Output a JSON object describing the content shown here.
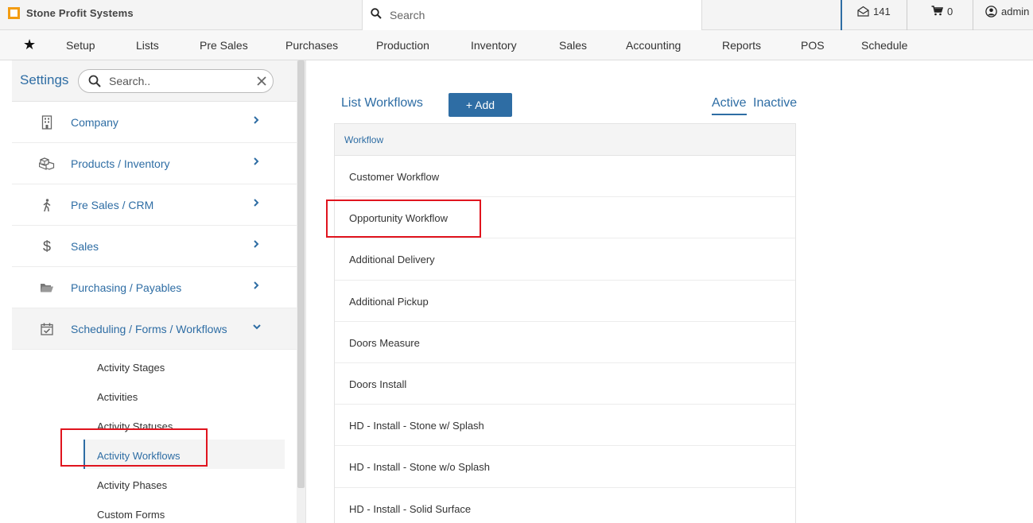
{
  "app": {
    "name": "Stone Profit Systems",
    "accent": "#2e6da4",
    "logo_color": "#f39c12",
    "highlight_color": "#e0141e"
  },
  "topbar": {
    "search_placeholder": "Search",
    "mail_count": "141",
    "cart_count": "0",
    "user": "admin"
  },
  "nav": {
    "items": [
      "Setup",
      "Lists",
      "Pre Sales",
      "Purchases",
      "Production",
      "Inventory",
      "Sales",
      "Accounting",
      "Reports",
      "POS",
      "Schedule"
    ]
  },
  "sidebar": {
    "title": "Settings",
    "search_placeholder": "Search..",
    "sections": [
      {
        "label": "Company",
        "icon": "building-icon",
        "expanded": false
      },
      {
        "label": "Products / Inventory",
        "icon": "boxes-icon",
        "expanded": false
      },
      {
        "label": "Pre Sales / CRM",
        "icon": "walking-person-icon",
        "expanded": false
      },
      {
        "label": "Sales",
        "icon": "dollar-icon",
        "expanded": false
      },
      {
        "label": "Purchasing / Payables",
        "icon": "folder-icon",
        "expanded": false
      },
      {
        "label": "Scheduling / Forms / Workflows",
        "icon": "calendar-check-icon",
        "expanded": true
      }
    ],
    "sub_items": [
      "Activity Stages",
      "Activities",
      "Activity Statuses",
      "Activity Workflows",
      "Activity Phases",
      "Custom Forms"
    ],
    "active_sub_item": "Activity Workflows"
  },
  "main": {
    "title": "List Workflows",
    "add_label": "+ Add",
    "tabs": [
      "Active",
      "Inactive"
    ],
    "active_tab": "Active",
    "table": {
      "header": "Workflow",
      "rows": [
        "Customer Workflow",
        "Opportunity Workflow",
        "Additional Delivery",
        "Additional Pickup",
        "Doors Measure",
        "Doors Install",
        "HD - Install - Stone w/ Splash",
        "HD - Install - Stone w/o Splash",
        "HD - Install - Solid Surface"
      ]
    }
  }
}
